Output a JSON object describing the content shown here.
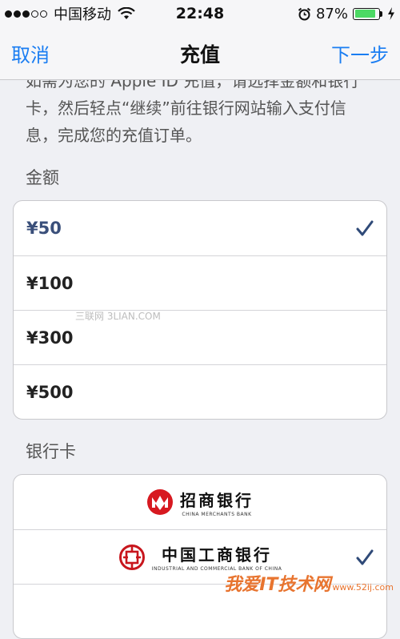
{
  "status_bar": {
    "carrier": "中国移动",
    "time": "22:48",
    "battery_percent_label": "87%",
    "battery_level": 0.87
  },
  "navbar": {
    "cancel_label": "取消",
    "title": "充值",
    "next_label": "下一步"
  },
  "description": "如需为您的 Apple ID 充值，请选择金额和银行卡，然后轻点“继续”前往银行网站输入支付信息，完成您的充值订单。",
  "amount_section": {
    "header": "金额",
    "options": [
      {
        "label": "¥50",
        "selected": true
      },
      {
        "label": "¥100",
        "selected": false
      },
      {
        "label": "¥300",
        "selected": false
      },
      {
        "label": "¥500",
        "selected": false
      }
    ]
  },
  "bank_section": {
    "header": "银行卡",
    "banks": [
      {
        "name": "招商银行",
        "english": "CHINA MERCHANTS BANK",
        "selected": false
      },
      {
        "name": "中国工商银行",
        "english": "INDUSTRIAL AND COMMERCIAL BANK OF CHINA",
        "selected": true
      }
    ]
  },
  "watermarks": {
    "top": "三联网 3LIAN.COM",
    "bottom_main": "我爱IT技术网",
    "bottom_sub": "www.52ij.com"
  },
  "colors": {
    "accent": "#1a7df2",
    "selected_text": "#3a4f7a",
    "check": "#2f4a78",
    "battery": "#4cd964",
    "cmb_red": "#d71920",
    "icbc_red": "#c8161d"
  }
}
